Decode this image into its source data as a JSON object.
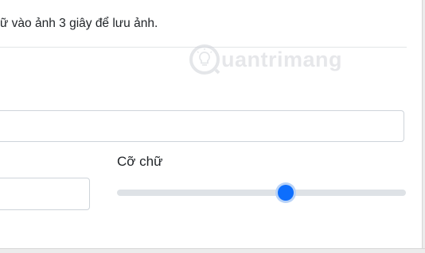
{
  "notice": {
    "text": "ữ vào ảnh 3 giây để lưu ảnh."
  },
  "watermark": {
    "text": "uantrimang",
    "icon": "lightbulb-logo-icon"
  },
  "text_field": {
    "value": ""
  },
  "font_size": {
    "label": "Cỡ chữ",
    "value_fraction": 0.585
  },
  "small_field": {
    "value": ""
  },
  "colors": {
    "accent": "#0d6efd",
    "track": "#dee2e6",
    "border": "#ced4da"
  }
}
